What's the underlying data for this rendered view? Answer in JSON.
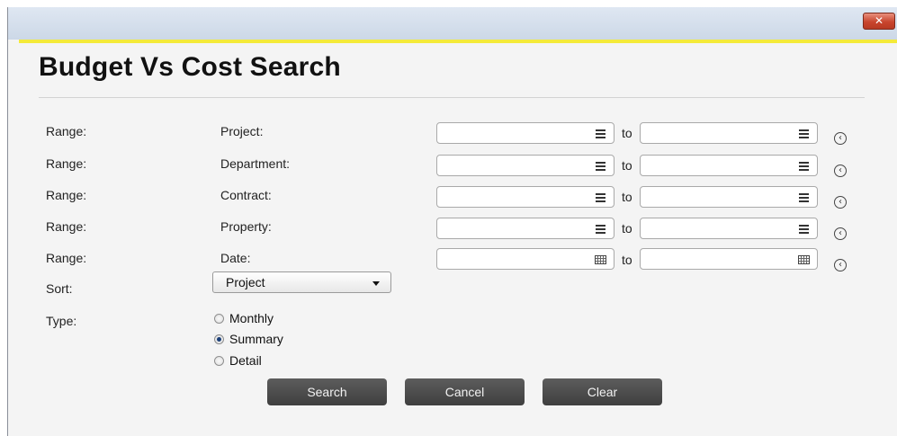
{
  "window": {
    "close_glyph": "✕"
  },
  "title": "Budget Vs Cost Search",
  "rows": [
    {
      "range_label": "Range:",
      "field_label": "Project:",
      "to_label": "to",
      "icon": "list-icon"
    },
    {
      "range_label": "Range:",
      "field_label": "Department:",
      "to_label": "to",
      "icon": "list-icon"
    },
    {
      "range_label": "Range:",
      "field_label": "Contract:",
      "to_label": "to",
      "icon": "list-icon"
    },
    {
      "range_label": "Range:",
      "field_label": "Property:",
      "to_label": "to",
      "icon": "list-icon"
    },
    {
      "range_label": "Range:",
      "field_label": "Date:",
      "to_label": "to",
      "icon": "calendar-icon"
    }
  ],
  "sort": {
    "label": "Sort:",
    "selected": "Project"
  },
  "type": {
    "label": "Type:",
    "options": [
      "Monthly",
      "Summary",
      "Detail"
    ],
    "selected": "Summary"
  },
  "buttons": {
    "search": "Search",
    "cancel": "Cancel",
    "clear": "Clear"
  },
  "colors": {
    "accent_bar": "#f4ea3a",
    "button": "#4a4a4a",
    "close": "#c8452e"
  }
}
